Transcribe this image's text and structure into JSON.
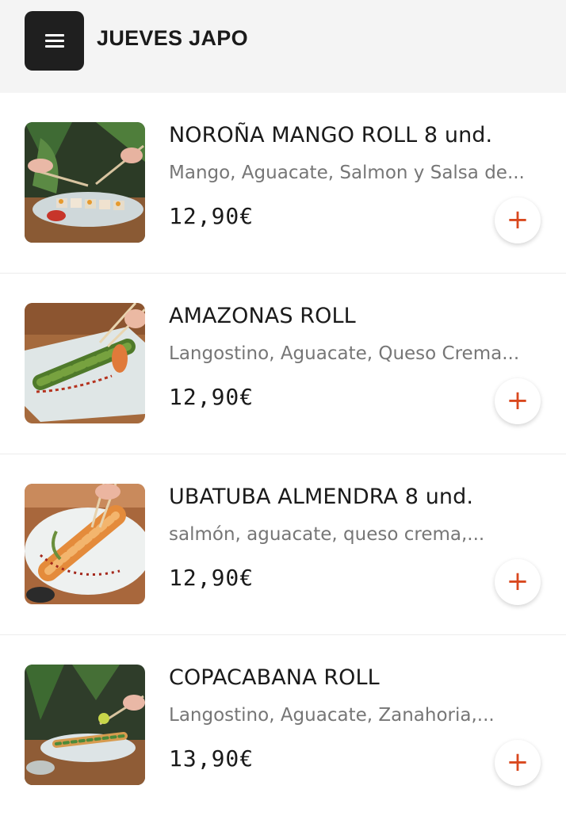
{
  "header": {
    "title": "JUEVES JAPO",
    "menu_icon": "hamburger-menu-icon"
  },
  "colors": {
    "accent": "#d9481e",
    "header_bg": "#f4f4f4",
    "menu_button_bg": "#1f1f1f"
  },
  "items": [
    {
      "name": "NOROÑA MANGO ROLL 8 und.",
      "description": "Mango, Aguacate, Salmon y Salsa de...",
      "price": "12,90€",
      "add_label": "+"
    },
    {
      "name": "AMAZONAS ROLL",
      "description": "Langostino, Aguacate, Queso Crema...",
      "price": "12,90€",
      "add_label": "+"
    },
    {
      "name": "UBATUBA ALMENDRA 8 und.",
      "description": "salmón, aguacate, queso crema,...",
      "price": "12,90€",
      "add_label": "+"
    },
    {
      "name": "COPACABANA ROLL",
      "description": "Langostino, Aguacate, Zanahoria,...",
      "price": "13,90€",
      "add_label": "+"
    }
  ]
}
